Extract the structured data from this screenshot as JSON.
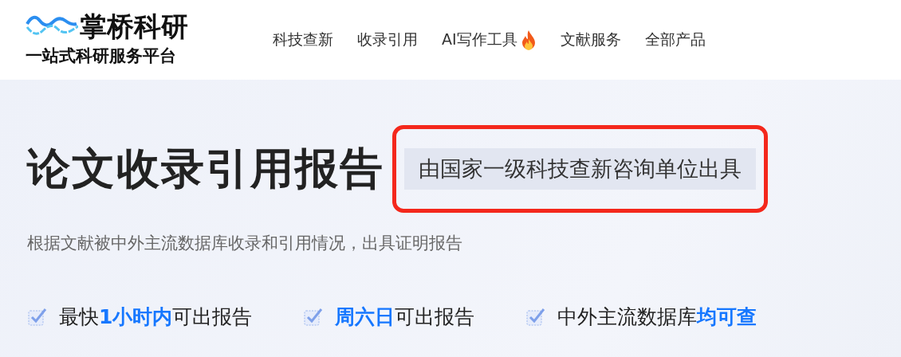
{
  "logo": {
    "name": "掌桥科研",
    "tagline": "一站式科研服务平台"
  },
  "nav": [
    {
      "label": "科技查新",
      "hot": false
    },
    {
      "label": "收录引用",
      "hot": false
    },
    {
      "label": "AI写作工具",
      "hot": true
    },
    {
      "label": "文献服务",
      "hot": false
    },
    {
      "label": "全部产品",
      "hot": false
    }
  ],
  "hero": {
    "title": "论文收录引用报告",
    "badge": {
      "text": "由国家一级科技查新咨询单位出具",
      "highlighted": true
    },
    "subtitle": "根据文献被中外主流数据库收录和引用情况，出具证明报告"
  },
  "features": [
    {
      "text": "最快**1小时内**可出报告",
      "checked": true
    },
    {
      "text": "**周六日**可出报告",
      "checked": true
    },
    {
      "text": "中外主流数据库**均可查**",
      "checked": true
    }
  ]
}
